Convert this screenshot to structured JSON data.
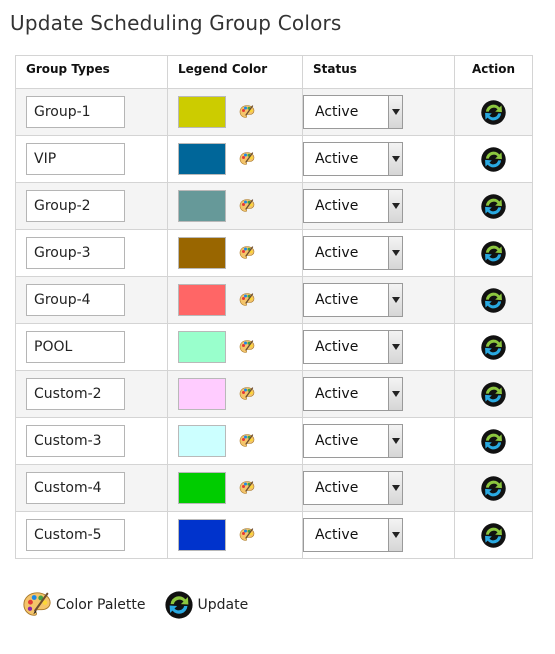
{
  "page": {
    "title": "Update Scheduling Group Colors"
  },
  "table": {
    "headers": {
      "group_types": "Group Types",
      "legend_color": "Legend Color",
      "status": "Status",
      "action": "Action"
    },
    "rows": [
      {
        "name": "Group-1",
        "color": "#cccc00",
        "status": "Active"
      },
      {
        "name": "VIP",
        "color": "#006699",
        "status": "Active"
      },
      {
        "name": "Group-2",
        "color": "#669999",
        "status": "Active"
      },
      {
        "name": "Group-3",
        "color": "#996600",
        "status": "Active"
      },
      {
        "name": "Group-4",
        "color": "#ff6666",
        "status": "Active"
      },
      {
        "name": "POOL",
        "color": "#99ffcc",
        "status": "Active"
      },
      {
        "name": "Custom-2",
        "color": "#ffccff",
        "status": "Active"
      },
      {
        "name": "Custom-3",
        "color": "#ccffff",
        "status": "Active"
      },
      {
        "name": "Custom-4",
        "color": "#00cc00",
        "status": "Active"
      },
      {
        "name": "Custom-5",
        "color": "#0033cc",
        "status": "Active"
      }
    ]
  },
  "icons": {
    "palette": "color-palette-icon",
    "update": "update-icon",
    "dropdown": "chevron-down-icon"
  },
  "footer": {
    "palette_label": "Color Palette",
    "update_label": "Update"
  }
}
